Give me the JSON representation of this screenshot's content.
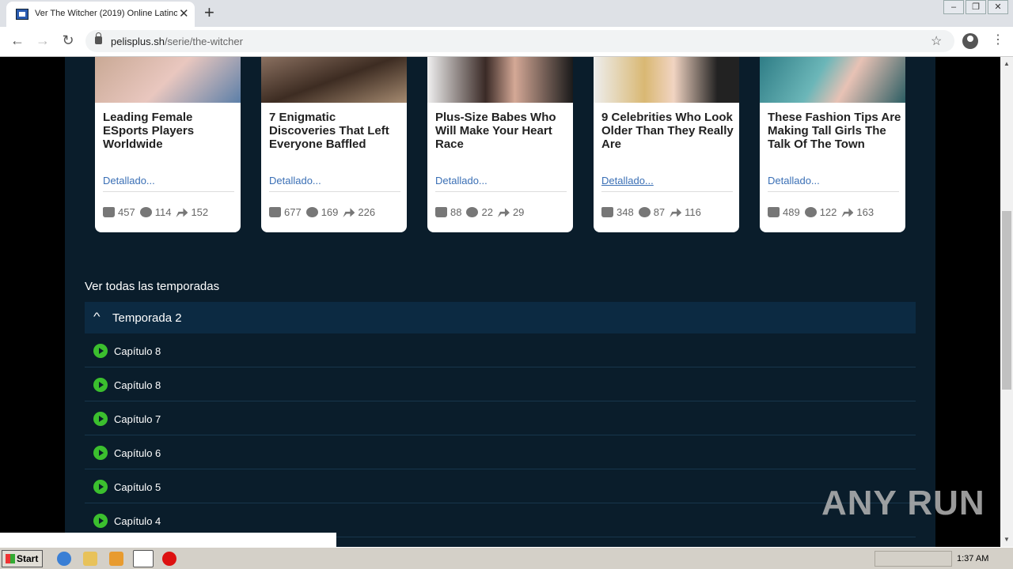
{
  "browser": {
    "tab_title": "Ver The Witcher (2019) Online Latino",
    "url_domain": "pelisplus.sh",
    "url_path": "/serie/the-witcher"
  },
  "cards": [
    {
      "title": "Leading Female ESports Players Worldwide",
      "more": "Detallado...",
      "likes": "457",
      "comments": "114",
      "shares": "152"
    },
    {
      "title": "7 Enigmatic Discoveries That Left Everyone Baffled",
      "more": "Detallado...",
      "likes": "677",
      "comments": "169",
      "shares": "226"
    },
    {
      "title": "Plus-Size Babes Who Will Make Your Heart Race",
      "more": "Detallado...",
      "likes": "88",
      "comments": "22",
      "shares": "29"
    },
    {
      "title": "9 Celebrities Who Look Older Than They Really Are",
      "more": "Detallado...",
      "likes": "348",
      "comments": "87",
      "shares": "116"
    },
    {
      "title": "These Fashion Tips Are Making Tall Girls The Talk Of The Town",
      "more": "Detallado...",
      "likes": "489",
      "comments": "122",
      "shares": "163"
    }
  ],
  "seasons_heading": "Ver todas las temporadas",
  "season": {
    "label": "Temporada 2"
  },
  "episodes": [
    "Capítulo 8",
    "Capítulo 8",
    "Capítulo 7",
    "Capítulo 6",
    "Capítulo 5",
    "Capítulo 4"
  ],
  "watermark": "ANY RUN",
  "taskbar": {
    "start_label": "Start",
    "clock": "1:37 AM"
  },
  "colors": {
    "page_bg": "#0a1d2b",
    "season_bg": "#0c2a42",
    "play_green": "#3bbf2e",
    "link_blue": "#3a6fb5"
  }
}
